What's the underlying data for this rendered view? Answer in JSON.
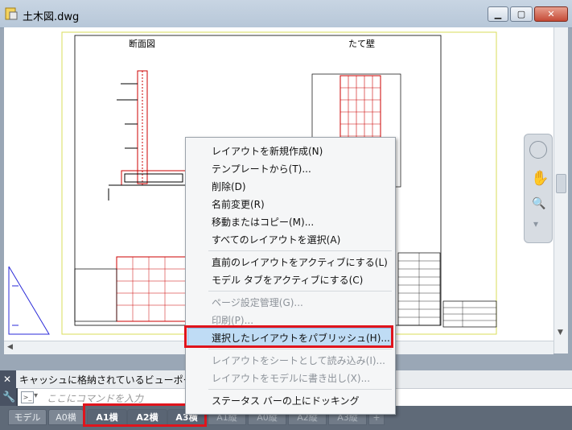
{
  "window": {
    "title": "土木図.dwg",
    "controls": [
      "minimize",
      "restore",
      "close"
    ]
  },
  "drawing": {
    "label_left": "断面図",
    "label_right": "たて壁"
  },
  "context_menu": {
    "items": [
      {
        "label": "レイアウトを新規作成(N)",
        "enabled": true
      },
      {
        "label": "テンプレートから(T)...",
        "enabled": true
      },
      {
        "label": "削除(D)",
        "enabled": true
      },
      {
        "label": "名前変更(R)",
        "enabled": true
      },
      {
        "label": "移動またはコピー(M)...",
        "enabled": true
      },
      {
        "label": "すべてのレイアウトを選択(A)",
        "enabled": true
      },
      {
        "label": "直前のレイアウトをアクティブにする(L)",
        "enabled": true
      },
      {
        "label": "モデル タブをアクティブにする(C)",
        "enabled": true
      },
      {
        "label": "ページ設定管理(G)...",
        "enabled": false
      },
      {
        "label": "印刷(P)...",
        "enabled": false
      },
      {
        "label": "選択したレイアウトをパブリッシュ(H)...",
        "enabled": true,
        "highlighted": true
      },
      {
        "label": "レイアウトをシートとして読み込み(I)...",
        "enabled": false
      },
      {
        "label": "レイアウトをモデルに書き出し(X)...",
        "enabled": false
      },
      {
        "label": "ステータス バーの上にドッキング",
        "enabled": true
      }
    ]
  },
  "command": {
    "history_text": "キャッシュに格納されているビューポートを呼",
    "prompt_placeholder": "ここにコマンドを入力"
  },
  "tabs": [
    {
      "label": "モデル",
      "selected": false
    },
    {
      "label": "A0横",
      "selected": false
    },
    {
      "label": "A1横",
      "selected": true
    },
    {
      "label": "A2横",
      "selected": true
    },
    {
      "label": "A3横",
      "selected": true
    },
    {
      "label": "A1縦",
      "selected": false
    },
    {
      "label": "A0縦",
      "selected": false
    },
    {
      "label": "A2縦",
      "selected": false
    },
    {
      "label": "A3縦",
      "selected": false
    }
  ],
  "colors": {
    "highlight_border": "#e0141c",
    "menu_highlight": "#bfdcf5",
    "tabbar": "#5f6a78"
  }
}
